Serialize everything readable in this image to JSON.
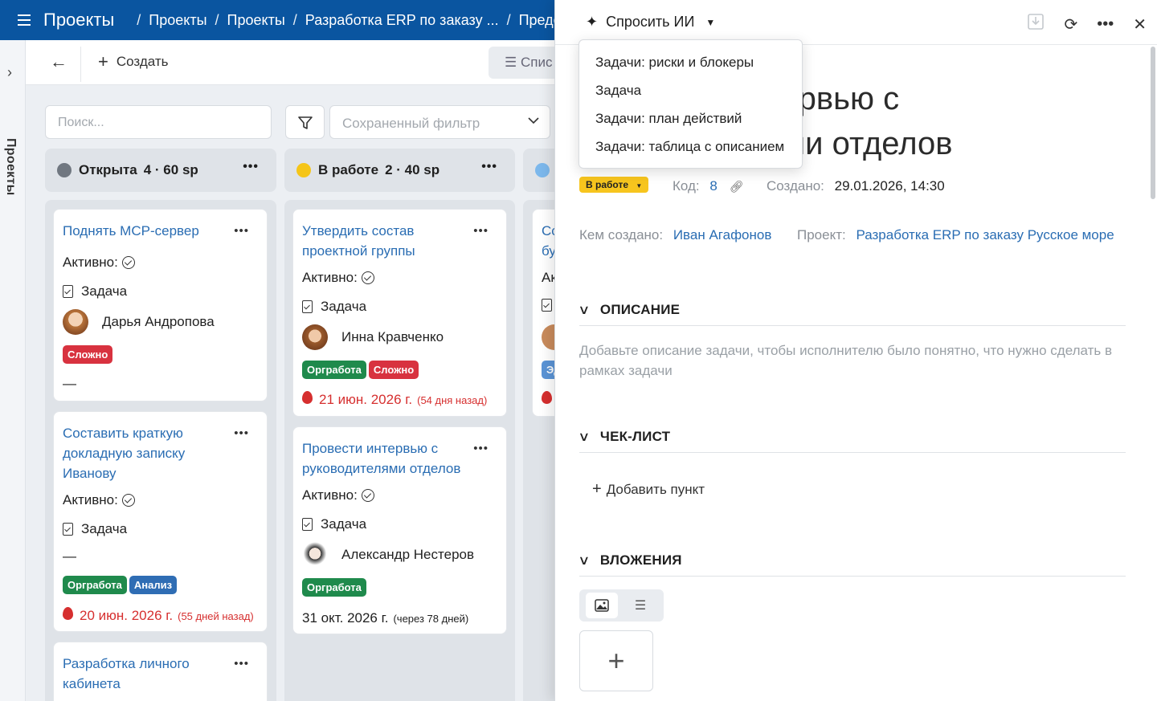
{
  "header": {
    "app_title": "Проекты",
    "breadcrumbs": [
      "Проекты",
      "Проекты",
      "Разработка ERP по заказу ...",
      "Предста"
    ]
  },
  "rail": {
    "label": "Проекты"
  },
  "toolbar": {
    "create_label": "Создать",
    "view_label": "Спис"
  },
  "filters": {
    "search_placeholder": "Поиск...",
    "saved_filter_placeholder": "Сохраненный фильтр"
  },
  "columns": [
    {
      "name": "Открыта",
      "count": "4 · 60 sp",
      "color": "#707780"
    },
    {
      "name": "В работе",
      "count": "2 · 40 sp",
      "color": "#f5c518"
    },
    {
      "color": "#7cb8ec"
    }
  ],
  "cards": {
    "c1": {
      "title": "Поднять MCP-сервер",
      "active": "Активно:",
      "type": "Задача",
      "assignee": "Дарья Андропова",
      "badge": "Сложно",
      "date": "—"
    },
    "c2": {
      "title": "Составить краткую докладную записку Иванову",
      "active": "Активно:",
      "type": "Задача",
      "assignee": "—",
      "badge1": "Оргработа",
      "badge2": "Анализ",
      "date": "20 июн. 2026 г.",
      "date_rel": "(55 дней назад)"
    },
    "c3": {
      "title": "Разработка личного кабинета"
    },
    "c4": {
      "title": "Утвердить состав проектной группы",
      "active": "Активно:",
      "type": "Задача",
      "assignee": "Инна Кравченко",
      "badge1": "Оргработа",
      "badge2": "Сложно",
      "date": "21 июн. 2026 г.",
      "date_rel": "(54 дня назад)"
    },
    "c5": {
      "title": "Провести интервью с руководителями отделов",
      "active": "Активно:",
      "type": "Задача",
      "assignee": "Александр Нестеров",
      "badge1": "Оргработа",
      "date": "31 окт. 2026 г.",
      "date_rel": "(через 78 дней)"
    },
    "c6": {
      "title_partial": "Сс бу",
      "active_partial": "Ак",
      "badge_partial": "Эд"
    }
  },
  "colors": {
    "brand": "#0a55a0",
    "link": "#2a6db3",
    "badge_red": "#d8323f",
    "badge_green": "#1f8a4c",
    "badge_blue": "#2f6db4",
    "status_yellow": "#f7c51e",
    "overdue": "#d62f2f"
  },
  "panel": {
    "ask_ai_label": "Спросить ИИ",
    "title_line1": "Провести интервью с",
    "title_line2": "руководителями отделов",
    "status": "В работе",
    "code_label": "Код:",
    "code_value": "8",
    "created_label": "Создано:",
    "created_value": "29.01.2026, 14:30",
    "author_label": "Кем создано:",
    "author_value": "Иван Агафонов",
    "project_label": "Проект:",
    "project_value": "Разработка ERP по заказу Русское море",
    "sections": {
      "description": "ОПИСАНИЕ",
      "description_hint": "Добавьте описание задачи, чтобы исполнителю было понятно, что нужно сделать в рамках задачи",
      "checklist": "ЧЕК-ЛИСТ",
      "add_item": "Добавить пункт",
      "attachments": "ВЛОЖЕНИЯ"
    }
  },
  "ai_menu": {
    "items": [
      "Задачи: риски и блокеры",
      "Задача",
      "Задачи: план действий",
      "Задачи: таблица с описанием"
    ]
  }
}
